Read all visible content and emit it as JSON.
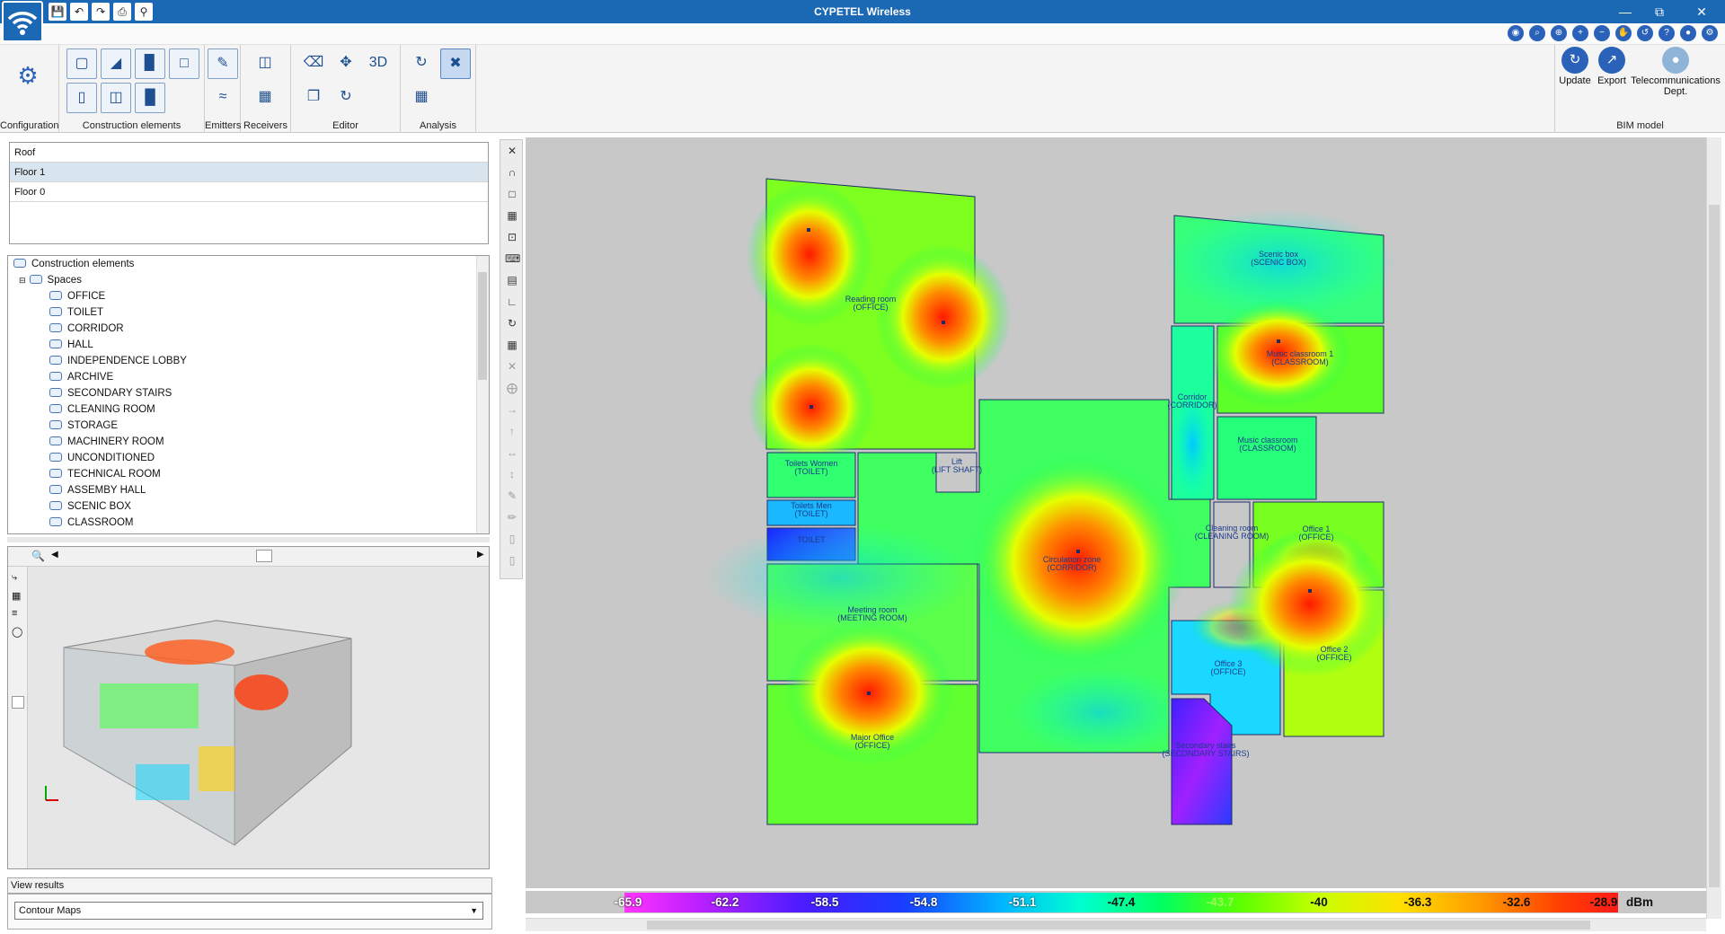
{
  "app": {
    "title": "CYPETEL Wireless"
  },
  "quick_access": {
    "items": [
      "save-icon",
      "undo-icon",
      "redo-icon",
      "print-icon",
      "print-preview-icon"
    ]
  },
  "ribbon": {
    "groups": [
      {
        "label": "Configuration"
      },
      {
        "label": "Construction elements"
      },
      {
        "label": "Emitters"
      },
      {
        "label": "Receivers"
      },
      {
        "label": "Editor"
      },
      {
        "label": "Analysis"
      },
      {
        "label": "BIM model"
      }
    ],
    "bim_buttons": [
      {
        "label": "Update"
      },
      {
        "label": "Export"
      },
      {
        "label": "Telecommunications Dept."
      }
    ]
  },
  "floors": {
    "items": [
      "Roof",
      "Floor 1",
      "Floor 0"
    ],
    "selected": "Floor 1"
  },
  "tree": {
    "root": "Construction elements",
    "group": "Spaces",
    "items": [
      "OFFICE",
      "TOILET",
      "CORRIDOR",
      "HALL",
      "INDEPENDENCE LOBBY",
      "ARCHIVE",
      "SECONDARY STAIRS",
      "CLEANING ROOM",
      "STORAGE",
      "MACHINERY ROOM",
      "UNCONDITIONED",
      "TECHNICAL ROOM",
      "ASSEMBY HALL",
      "SCENIC BOX",
      "CLASSROOM"
    ]
  },
  "view_results": {
    "label": "View results",
    "selected": "Contour Maps"
  },
  "rooms": [
    {
      "name": "Reading room",
      "type": "(OFFICE)"
    },
    {
      "name": "Scenic box",
      "type": "(SCENIC BOX)"
    },
    {
      "name": "Music classroom 1",
      "type": "(CLASSROOM)"
    },
    {
      "name": "Corridor",
      "type": "(CORRIDOR)"
    },
    {
      "name": "Music classroom",
      "type": "(CLASSROOM)"
    },
    {
      "name": "Toilets Women",
      "type": "(TOILET)"
    },
    {
      "name": "Toilets Men",
      "type": "(TOILET)"
    },
    {
      "name": "",
      "type": "TOILET"
    },
    {
      "name": "Lift",
      "type": "(LIFT SHAFT)"
    },
    {
      "name": "Circulation zone",
      "type": "(CORRIDOR)"
    },
    {
      "name": "Cleaning room",
      "type": "(CLEANING ROOM)"
    },
    {
      "name": "Office 1",
      "type": "(OFFICE)"
    },
    {
      "name": "Meeting room",
      "type": "(MEETING ROOM)"
    },
    {
      "name": "Office 3",
      "type": "(OFFICE)"
    },
    {
      "name": "Office 2",
      "type": "(OFFICE)"
    },
    {
      "name": "Major Office",
      "type": "(OFFICE)"
    },
    {
      "name": "Secondary stairs",
      "type": "(SECONDARY STAIRS)"
    }
  ],
  "legend": {
    "ticks": [
      "-65.9",
      "-62.2",
      "-58.5",
      "-54.8",
      "-51.1",
      "-47.4",
      "-43.7",
      "-40",
      "-36.3",
      "-32.6",
      "-28.9"
    ],
    "unit": "dBm",
    "colors": [
      "#ff33ff",
      "#4a1cff",
      "#00b6ff",
      "#00ff63",
      "#ffe000",
      "#ff1a1a"
    ]
  }
}
